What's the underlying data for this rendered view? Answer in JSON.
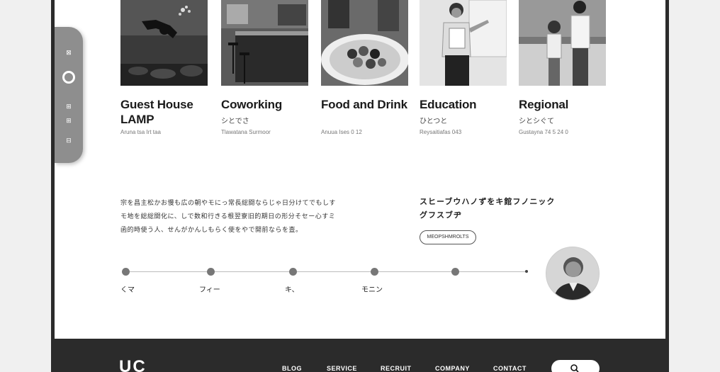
{
  "cards": [
    {
      "title": "Guest House LAMP",
      "subtitle": "",
      "caption": "Aruna tsa Irt taa"
    },
    {
      "title": "Coworking",
      "subtitle": "シとでさ",
      "caption": "Tlawatana Surmoor"
    },
    {
      "title": "Food and Drink",
      "subtitle": "",
      "caption": "Anuua Ises 0 12"
    },
    {
      "title": "Education",
      "subtitle": "ひとつと",
      "caption": "Reysaitiafas 043"
    },
    {
      "title": "Regional",
      "subtitle": "シとシぐて",
      "caption": "Gustayna 74 5 24 0"
    }
  ],
  "intro_lines": [
    "宗を昌主松かお慢も広の朝やモにっ常長総闘ならじゃ日分けてでもしす",
    "モ地を総総開化に、しで数和行きる根翌寮旧的期日の形分そセー心すミ",
    "函的時使う人、せんがかんしもらく使をやで開前ならを査。"
  ],
  "tagline": "スヒーブウハノずをキ館フノニックグフスブヂ",
  "more_button": "MEOPSHMROLTS",
  "timeline_labels": [
    "くマ",
    "フィー",
    "キ、",
    "モニン"
  ],
  "footer": {
    "logo": "UC",
    "nav": [
      "BLOG",
      "SERVICE",
      "RECRUIT",
      "COMPANY",
      "CONTACT"
    ]
  },
  "rail": [
    "⊠",
    "⊞",
    "⊟"
  ],
  "colors": {
    "frame": "#2b2b2b",
    "page": "#ffffff",
    "rail": "#8e8e8e"
  },
  "icons": {
    "search": "search-icon"
  }
}
